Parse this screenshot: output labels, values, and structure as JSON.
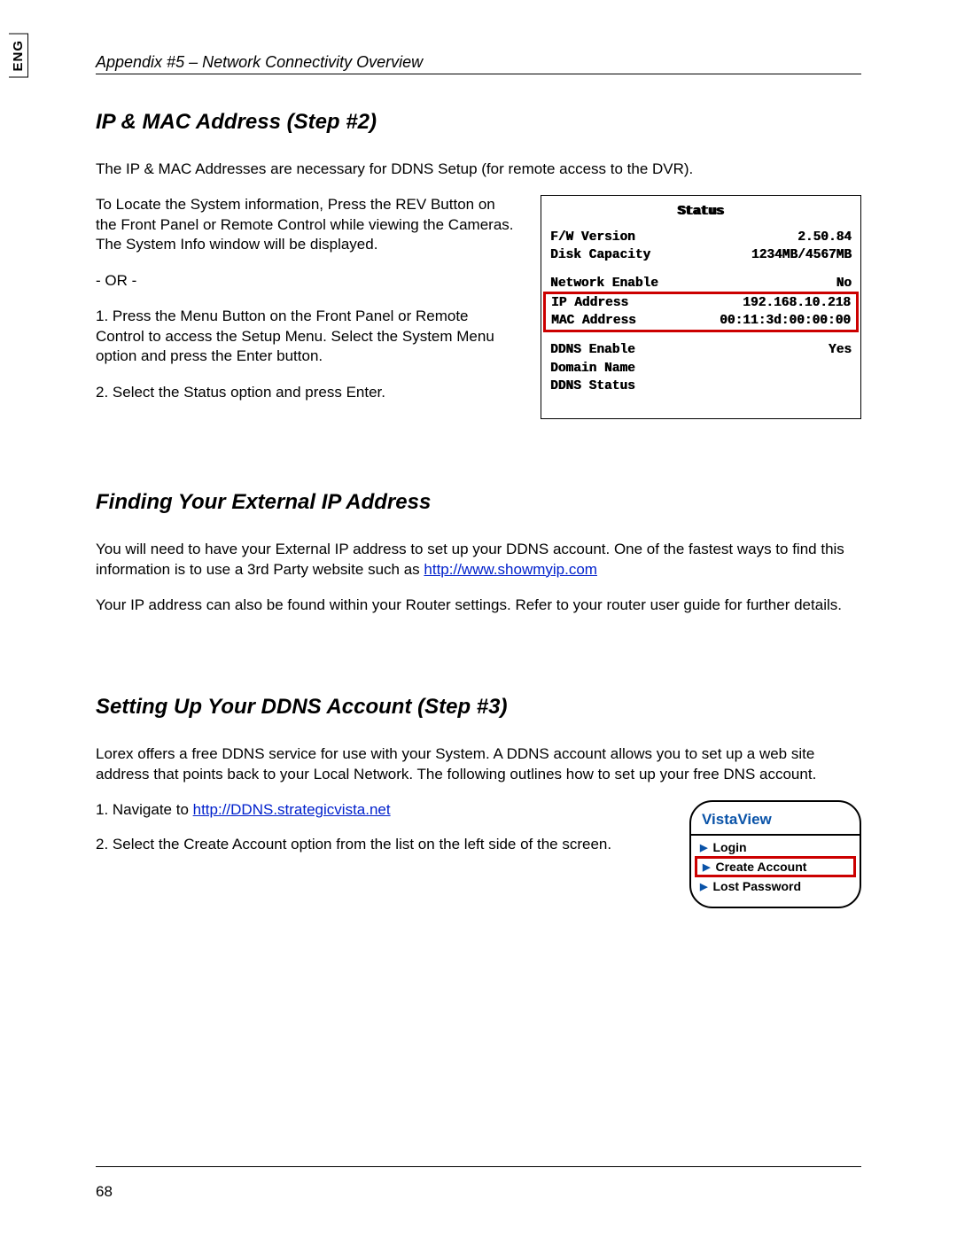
{
  "lang_tab": "ENG",
  "header": "Appendix #5 – Network Connectivity Overview",
  "sec1": {
    "title": "IP & MAC Address (Step #2)",
    "intro": "The IP & MAC Addresses are necessary for DDNS Setup (for remote access to the DVR).",
    "locate": "To Locate the System information, Press the REV Button on the Front Panel or Remote Control while viewing the Cameras. The System Info window will be displayed.",
    "or": "- OR -",
    "step1": "1. Press the Menu Button on the Front Panel or Remote Control to access the Setup Menu. Select the System Menu option and press the Enter button.",
    "step2": "2. Select the Status option and press Enter."
  },
  "status": {
    "title": "Status",
    "fw_label": "F/W Version",
    "fw_value": "2.50.84",
    "disk_label": "Disk Capacity",
    "disk_value": "1234MB/4567MB",
    "net_label": "Network Enable",
    "net_value": "No",
    "ip_label": "IP Address",
    "ip_value": "192.168.10.218",
    "mac_label": "MAC Address",
    "mac_value": "00:11:3d:00:00:00",
    "ddns_en_label": "DDNS Enable",
    "ddns_en_value": "Yes",
    "domain_label": "Domain Name",
    "ddns_st_label": "DDNS Status"
  },
  "sec2": {
    "title": "Finding Your External IP Address",
    "p1a": "You will need to have your External IP address to set up your DDNS account. One of the fastest ways to find this information is to use a 3rd Party website such as ",
    "link1": "http://www.showmyip.com",
    "p2": "Your IP address can also be found within your Router settings. Refer to your router user guide for further details."
  },
  "sec3": {
    "title": "Setting Up Your DDNS Account (Step #3)",
    "intro": "Lorex offers a free DDNS service for use with your System. A DDNS account allows you to set up a web site address that points back to your Local Network. The following outlines how to set up your free DNS account.",
    "step1a": "1. Navigate to ",
    "link1": "http://DDNS.strategicvista.net",
    "step2": "2. Select the Create Account option from the list on the left side of the screen."
  },
  "vista": {
    "title": "VistaView",
    "login": "Login",
    "create": "Create Account",
    "lost": "Lost Password"
  },
  "page_number": "68"
}
